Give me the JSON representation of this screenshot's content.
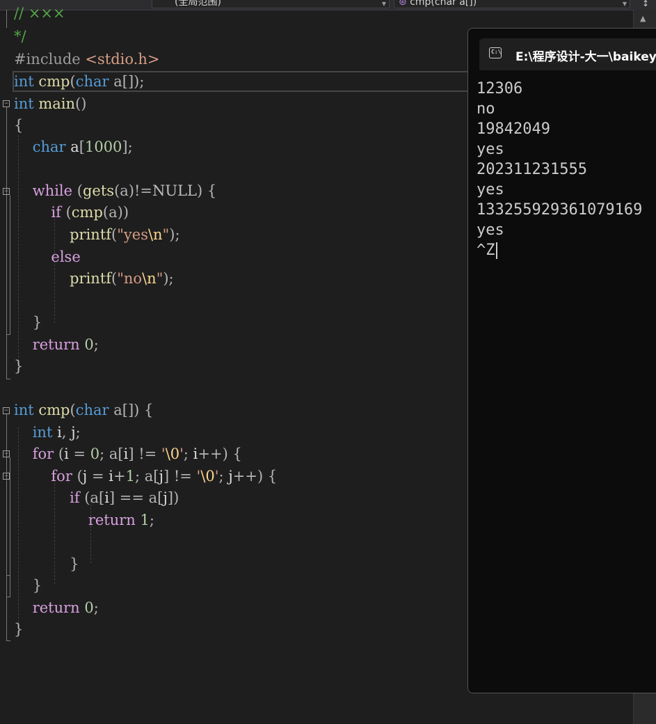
{
  "navbar": {
    "scope_label": "(全局范围)",
    "function_label": "cmp(char a[])",
    "split_button": "↕"
  },
  "editor": {
    "lines": {
      "l1": "// ×××",
      "l2": "*/",
      "l3_pp": "#include",
      "l3_hdr": "<stdio.h>",
      "int": "int",
      "char": "char",
      "main": "main",
      "cmp": "cmp",
      "while": "while",
      "gets": "gets",
      "null": "NULL",
      "if": "if",
      "else": "else",
      "for": "for",
      "return": "return",
      "printf": "printf",
      "yes_str": "\"yes",
      "no_str": "\"no",
      "nl_esc": "\\n",
      "quote": "\"",
      "nul_esc": "\\0",
      "n1000": "1000",
      "n0": "0",
      "n1": "1"
    }
  },
  "console": {
    "title": "E:\\程序设计-大一\\baikeyu",
    "icon_text": "C:\\",
    "output": [
      "12306",
      "no",
      "19842049",
      "yes",
      "202311231555",
      "yes",
      "133255929361079169",
      "yes",
      "^Z"
    ]
  },
  "colors": {
    "editor_bg": "#1e1e1e",
    "keyword": "#569cd6",
    "control": "#d8a0df",
    "function": "#dcdcaa",
    "string": "#d69d85",
    "number": "#b5cea8",
    "comment": "#57a64a",
    "console_bg": "#0c0c0c"
  }
}
